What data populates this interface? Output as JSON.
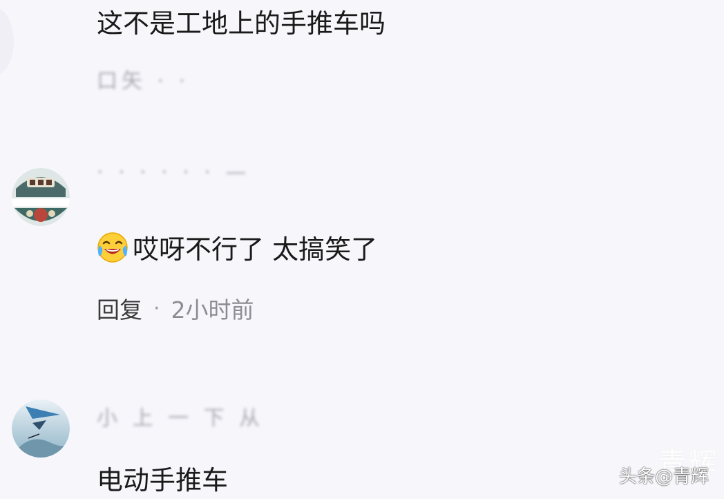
{
  "comments": [
    {
      "text": "这不是工地上的手推车吗",
      "username": "口矢 · ·",
      "avatar_icon": "avatar-partial-icon"
    },
    {
      "username": "· ·  ·  ·  ·  ·  —",
      "emoji_icon": "laughing-crying-emoji-icon",
      "text": "哎呀不行了 太搞笑了",
      "reply_label": "回复",
      "separator": "·",
      "time": "2小时前",
      "avatar_icon": "avatar-badge-icon"
    },
    {
      "username": "小 上 一  下 从",
      "text": "电动手推车",
      "avatar_icon": "avatar-sky-icon"
    }
  ],
  "watermark": {
    "text": "头条@青辉",
    "ghost_text": "青辉"
  },
  "colors": {
    "background": "#f7f6fb",
    "text": "#1a1a1a",
    "meta": "#8c8c92"
  }
}
